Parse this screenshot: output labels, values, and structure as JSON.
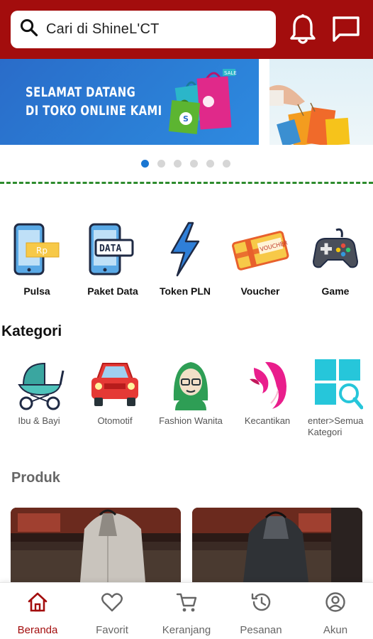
{
  "header": {
    "search_placeholder": "Cari di ShineL'CT"
  },
  "banner": {
    "line1": "SELAMAT DATANG",
    "line2": "DI TOKO ONLINE KAMI",
    "bag_tag": "SALE"
  },
  "carousel": {
    "active_index": 0,
    "count": 6
  },
  "services": [
    {
      "label": "Pulsa",
      "icon": "phone-credit-icon",
      "tag": "Rp"
    },
    {
      "label": "Paket Data",
      "icon": "data-package-icon",
      "tag": "DATA"
    },
    {
      "label": "Token PLN",
      "icon": "lightning-icon"
    },
    {
      "label": "Voucher",
      "icon": "voucher-icon",
      "tag": "VOUCHER"
    },
    {
      "label": "Game",
      "icon": "gamepad-icon"
    }
  ],
  "kategori": {
    "title": "Kategori",
    "items": [
      {
        "label": "Ibu & Bayi",
        "icon": "stroller-icon"
      },
      {
        "label": "Otomotif",
        "icon": "car-icon"
      },
      {
        "label": "Fashion Wanita",
        "icon": "woman-icon"
      },
      {
        "label": "Kecantikan",
        "icon": "beauty-icon"
      },
      {
        "label": "enter>Semua Kategori",
        "icon": "all-categories-icon"
      }
    ]
  },
  "produk": {
    "title": "Produk"
  },
  "bottom_nav": [
    {
      "label": "Beranda",
      "icon": "home-icon",
      "active": true
    },
    {
      "label": "Favorit",
      "icon": "heart-icon",
      "active": false
    },
    {
      "label": "Keranjang",
      "icon": "cart-icon",
      "active": false
    },
    {
      "label": "Pesanan",
      "icon": "history-icon",
      "active": false
    },
    {
      "label": "Akun",
      "icon": "account-icon",
      "active": false
    }
  ],
  "colors": {
    "brand": "#a30d0d",
    "accent": "#1976d2",
    "divider": "#2e8b2e"
  }
}
